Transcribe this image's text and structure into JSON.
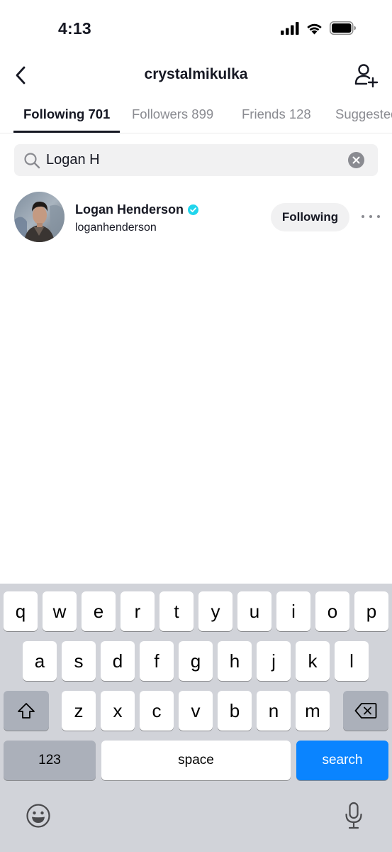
{
  "status_bar": {
    "time": "4:13"
  },
  "header": {
    "title": "crystalmikulka"
  },
  "tabs": [
    {
      "label": "Following 701"
    },
    {
      "label": "Followers 899"
    },
    {
      "label": "Friends 128"
    },
    {
      "label": "Suggested"
    }
  ],
  "search": {
    "value": "Logan H"
  },
  "results": [
    {
      "display_name": "Logan Henderson",
      "username": "loganhenderson",
      "verified": true,
      "button_label": "Following"
    }
  ],
  "keyboard": {
    "row1": [
      "q",
      "w",
      "e",
      "r",
      "t",
      "y",
      "u",
      "i",
      "o",
      "p"
    ],
    "row2": [
      "a",
      "s",
      "d",
      "f",
      "g",
      "h",
      "j",
      "k",
      "l"
    ],
    "row3": [
      "z",
      "x",
      "c",
      "v",
      "b",
      "n",
      "m"
    ],
    "numbers_label": "123",
    "space_label": "space",
    "search_label": "search"
  },
  "colors": {
    "accent": "#0a84ff",
    "verified": "#20d5ec",
    "text": "#161823",
    "muted": "#8a8b91"
  }
}
